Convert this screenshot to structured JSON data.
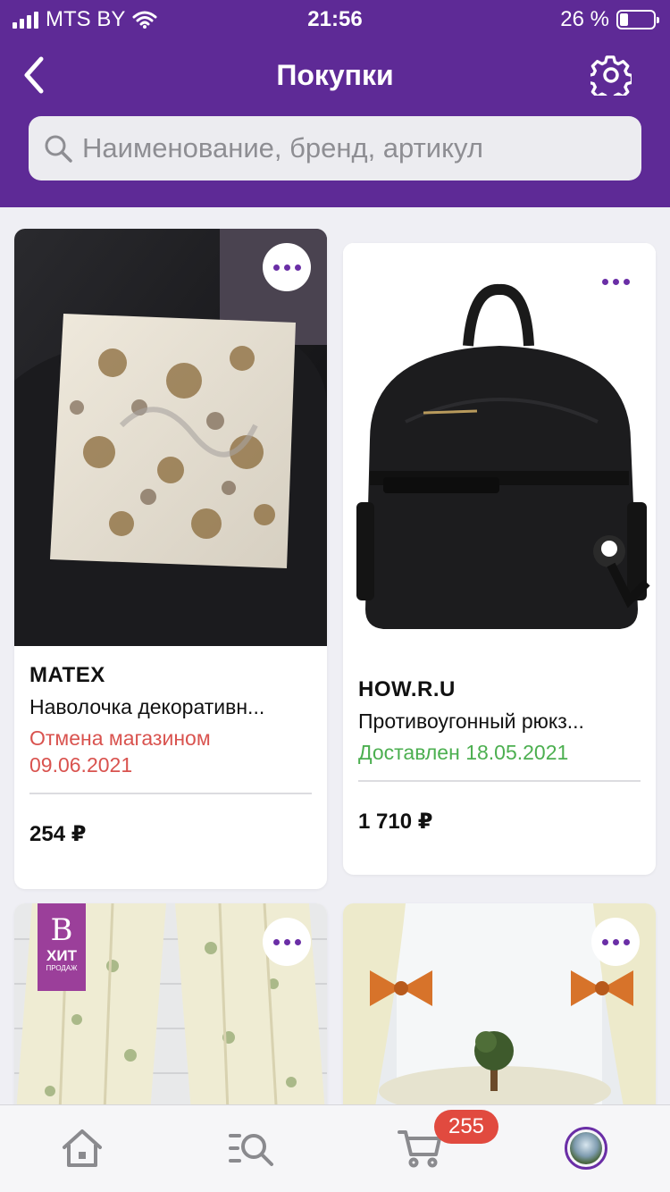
{
  "status_bar": {
    "carrier": "MTS BY",
    "time": "21:56",
    "battery": "26 %"
  },
  "header": {
    "title": "Покупки"
  },
  "search": {
    "placeholder": "Наименование, бренд, артикул"
  },
  "orders": [
    {
      "brand": "MATEX",
      "name": "Наволочка декоративн...",
      "status": "Отмена магазином 09.06.2021",
      "status_color": "#d9534f",
      "price": "254 ₽"
    },
    {
      "brand": "HOW.R.U",
      "name": "Противоугонный рюкз...",
      "status": "Доставлен 18.05.2021",
      "status_color": "#4caf50",
      "price": "1 710 ₽"
    }
  ],
  "promo_badge": {
    "top": "ХИТ",
    "bottom": "ПРОДАЖ"
  },
  "tabbar": {
    "cart_count": "255"
  },
  "colors": {
    "brand_purple": "#5e2a96",
    "accent": "#6a2ea6",
    "badge_red": "#e14a3f"
  }
}
